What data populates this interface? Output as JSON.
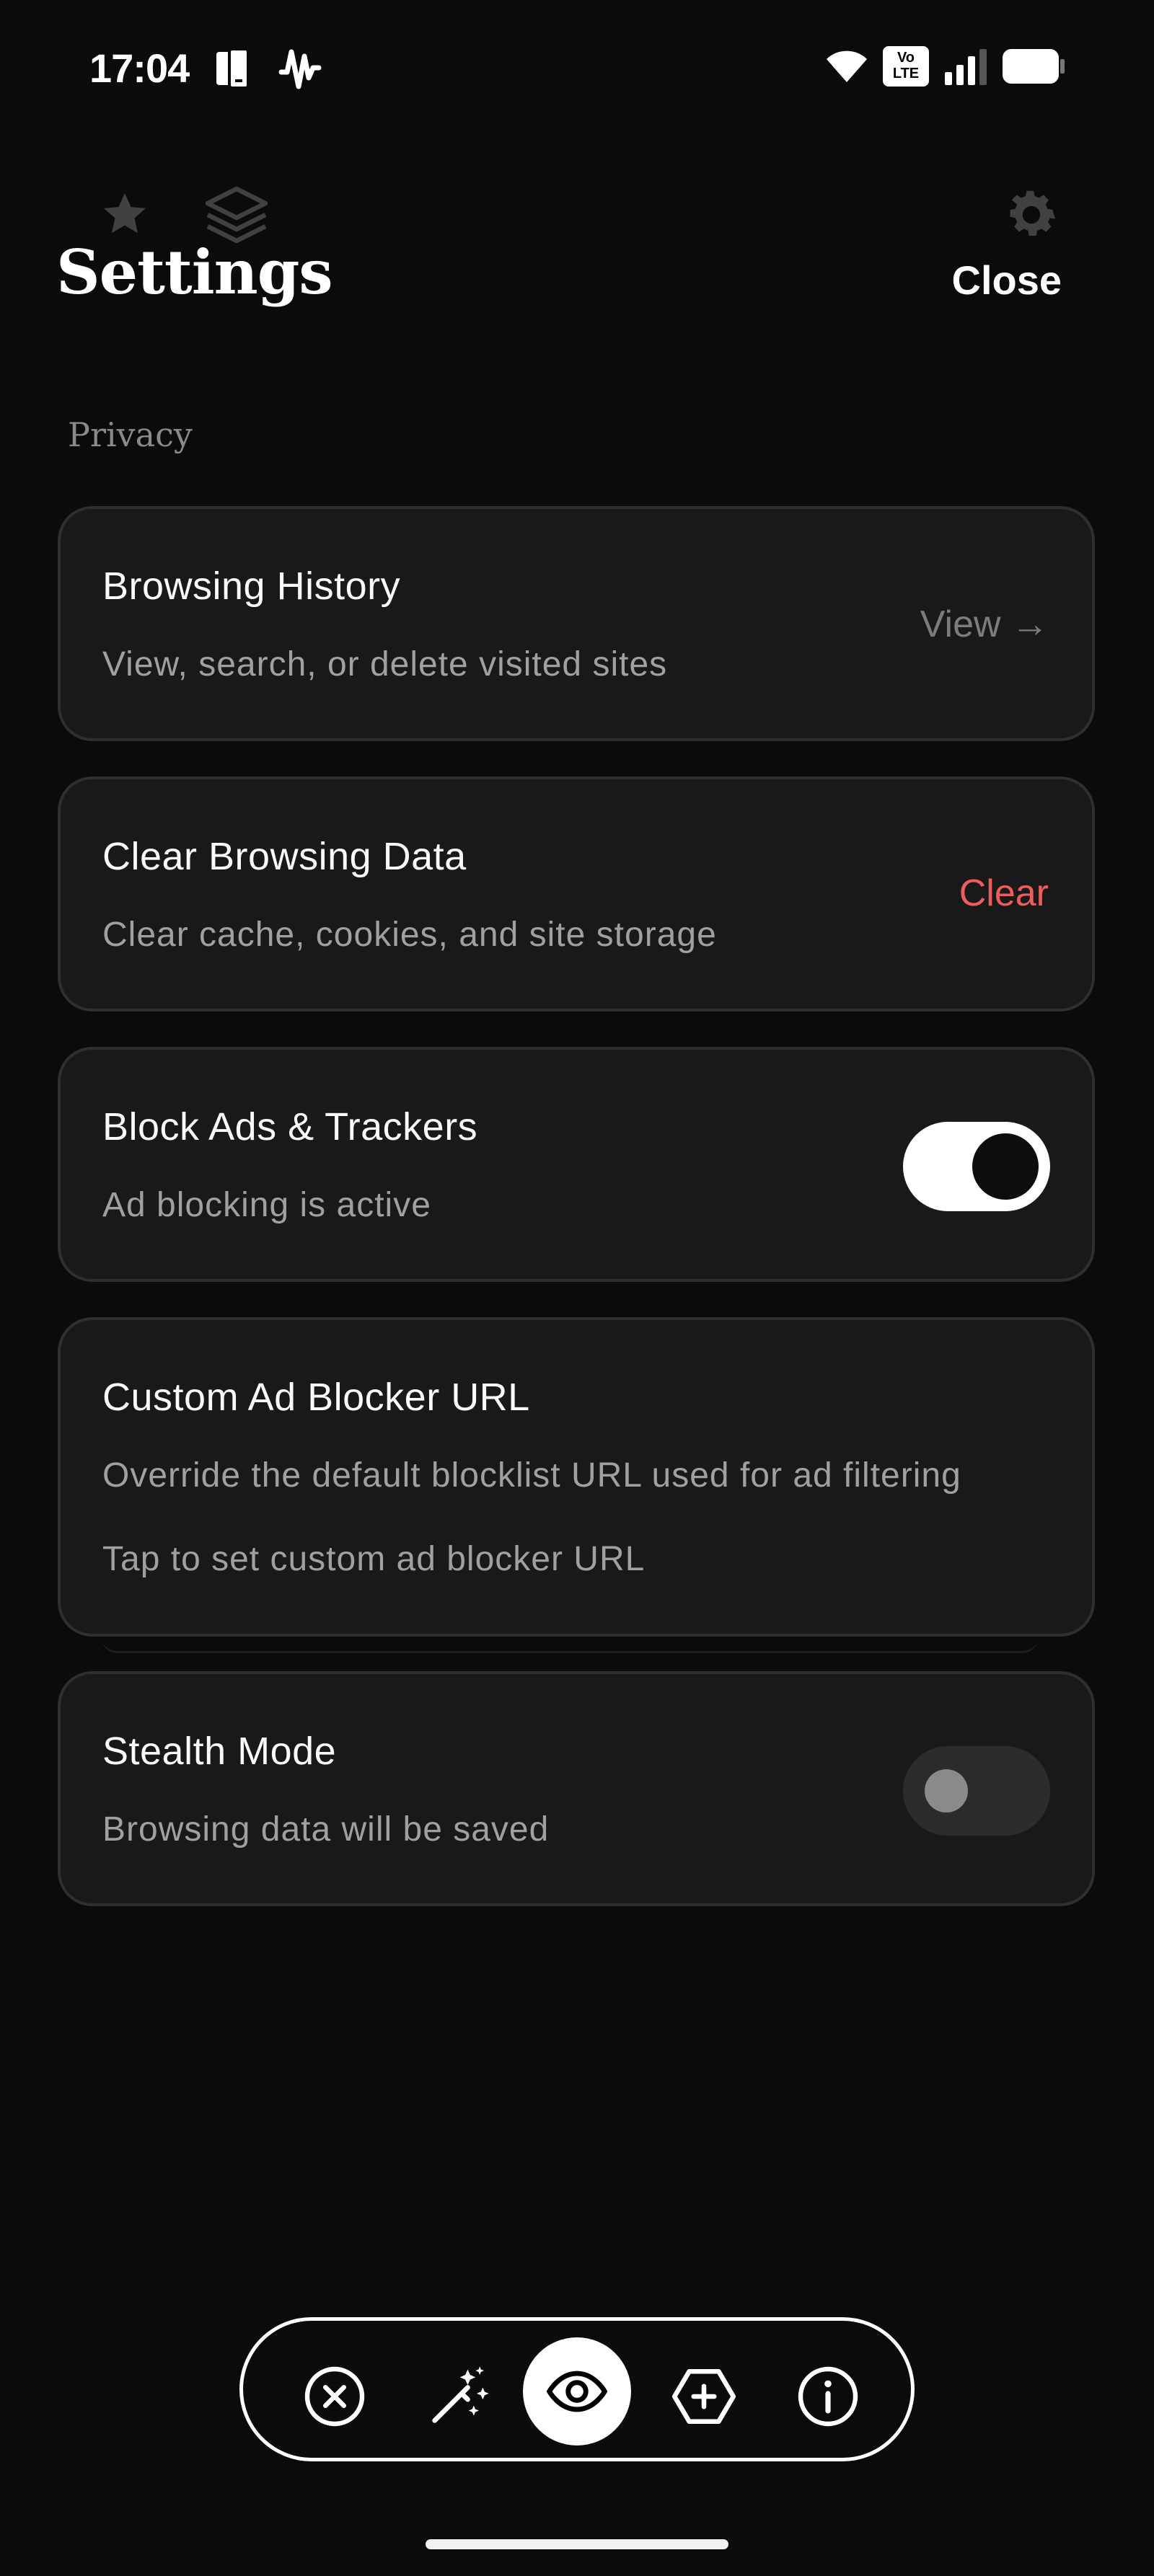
{
  "status_bar": {
    "time": "17:04",
    "volte_label_top": "Vo",
    "volte_label_bottom": "LTE",
    "icons": [
      "phone-tablet-icon",
      "waveform-icon",
      "wifi-icon",
      "volte-icon",
      "cell-signal-icon",
      "battery-icon"
    ]
  },
  "header": {
    "title": "Settings",
    "close_label": "Close",
    "faded_icons": [
      "star-icon",
      "layers-icon",
      "gear-icon"
    ]
  },
  "section": {
    "label": "Privacy"
  },
  "cards": [
    {
      "title": "Browsing History",
      "subtitle": "View, search, or delete visited sites",
      "action": "View →"
    },
    {
      "title": "Clear Browsing Data",
      "subtitle": "Clear cache, cookies, and site storage",
      "action": "Clear"
    },
    {
      "title": "Block Ads & Trackers",
      "subtitle": "Ad blocking is active",
      "toggle_on": true
    },
    {
      "title": "Custom Ad Blocker URL",
      "subtitle": "Override the default blocklist URL used for ad filtering",
      "hint": "Tap to set custom ad blocker URL"
    },
    {
      "title": "Stealth Mode",
      "subtitle": "Browsing data will be saved",
      "toggle_on": false
    }
  ],
  "bottom_nav": {
    "items": [
      "close-circle-icon",
      "magic-wand-icon",
      "eye-icon",
      "hexagon-plus-icon",
      "info-icon"
    ],
    "active": "eye-icon"
  },
  "colors": {
    "background": "#0b0b0b",
    "card": "#191919",
    "danger": "#ec5d5d",
    "muted": "#a0a0a0"
  }
}
